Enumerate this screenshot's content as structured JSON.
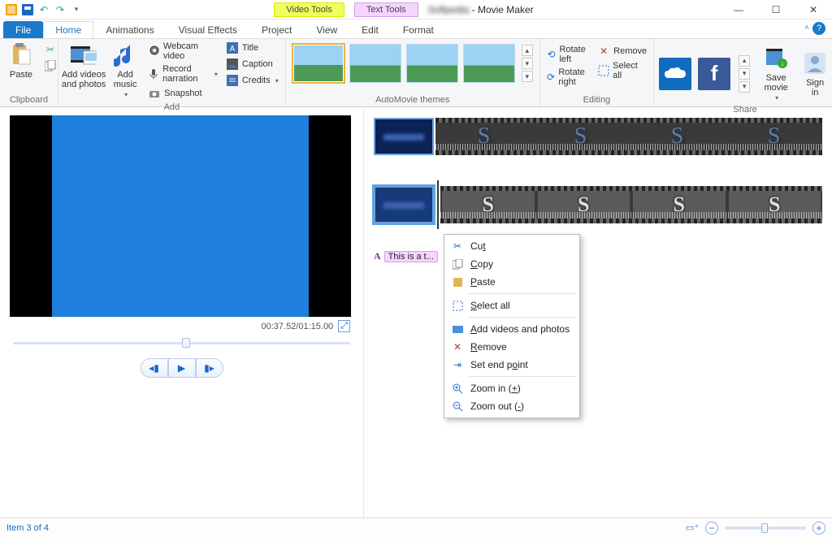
{
  "titlebar": {
    "tool_tabs": {
      "video": "Video Tools",
      "text": "Text Tools"
    },
    "title": "Movie Maker",
    "title_separator": " - "
  },
  "tabs": {
    "file": "File",
    "items": [
      "Home",
      "Animations",
      "Visual Effects",
      "Project",
      "View",
      "Edit",
      "Format"
    ],
    "active_index": 0
  },
  "ribbon": {
    "clipboard": {
      "paste": "Paste",
      "group_label": "Clipboard"
    },
    "add": {
      "add_videos": "Add videos\nand photos",
      "add_music": "Add\nmusic",
      "webcam": "Webcam video",
      "record_narration": "Record narration",
      "snapshot": "Snapshot",
      "title": "Title",
      "caption": "Caption",
      "credits": "Credits",
      "group_label": "Add"
    },
    "automovie": {
      "group_label": "AutoMovie themes"
    },
    "editing": {
      "rotate_left": "Rotate left",
      "rotate_right": "Rotate right",
      "remove": "Remove",
      "select_all": "Select all",
      "group_label": "Editing"
    },
    "share": {
      "save_movie": "Save\nmovie",
      "sign_in": "Sign\nin",
      "group_label": "Share"
    }
  },
  "preview": {
    "timecode": "00:37.52/01:15.00",
    "slider_percent": 50
  },
  "timeline": {
    "text_track_label": "This is a t..."
  },
  "context_menu": {
    "items": [
      {
        "id": "cut",
        "label": "Cu<u>t</u>"
      },
      {
        "id": "copy",
        "label": "<u>C</u>opy"
      },
      {
        "id": "paste",
        "label": "<u>P</u>aste"
      },
      {
        "sep": true
      },
      {
        "id": "select-all",
        "label": "<u>S</u>elect all"
      },
      {
        "sep": true
      },
      {
        "id": "add-videos",
        "label": "<u>A</u>dd videos and photos"
      },
      {
        "id": "remove",
        "label": "<u>R</u>emove"
      },
      {
        "id": "set-end",
        "label": "Set end p<u>o</u>int"
      },
      {
        "sep": true
      },
      {
        "id": "zoom-in",
        "label": "Zoom in (<u>+</u>)"
      },
      {
        "id": "zoom-out",
        "label": "Zoom out (<u>-</u>)"
      }
    ]
  },
  "status": {
    "item_text": "Item 3 of 4",
    "zoom_percent": 45
  }
}
